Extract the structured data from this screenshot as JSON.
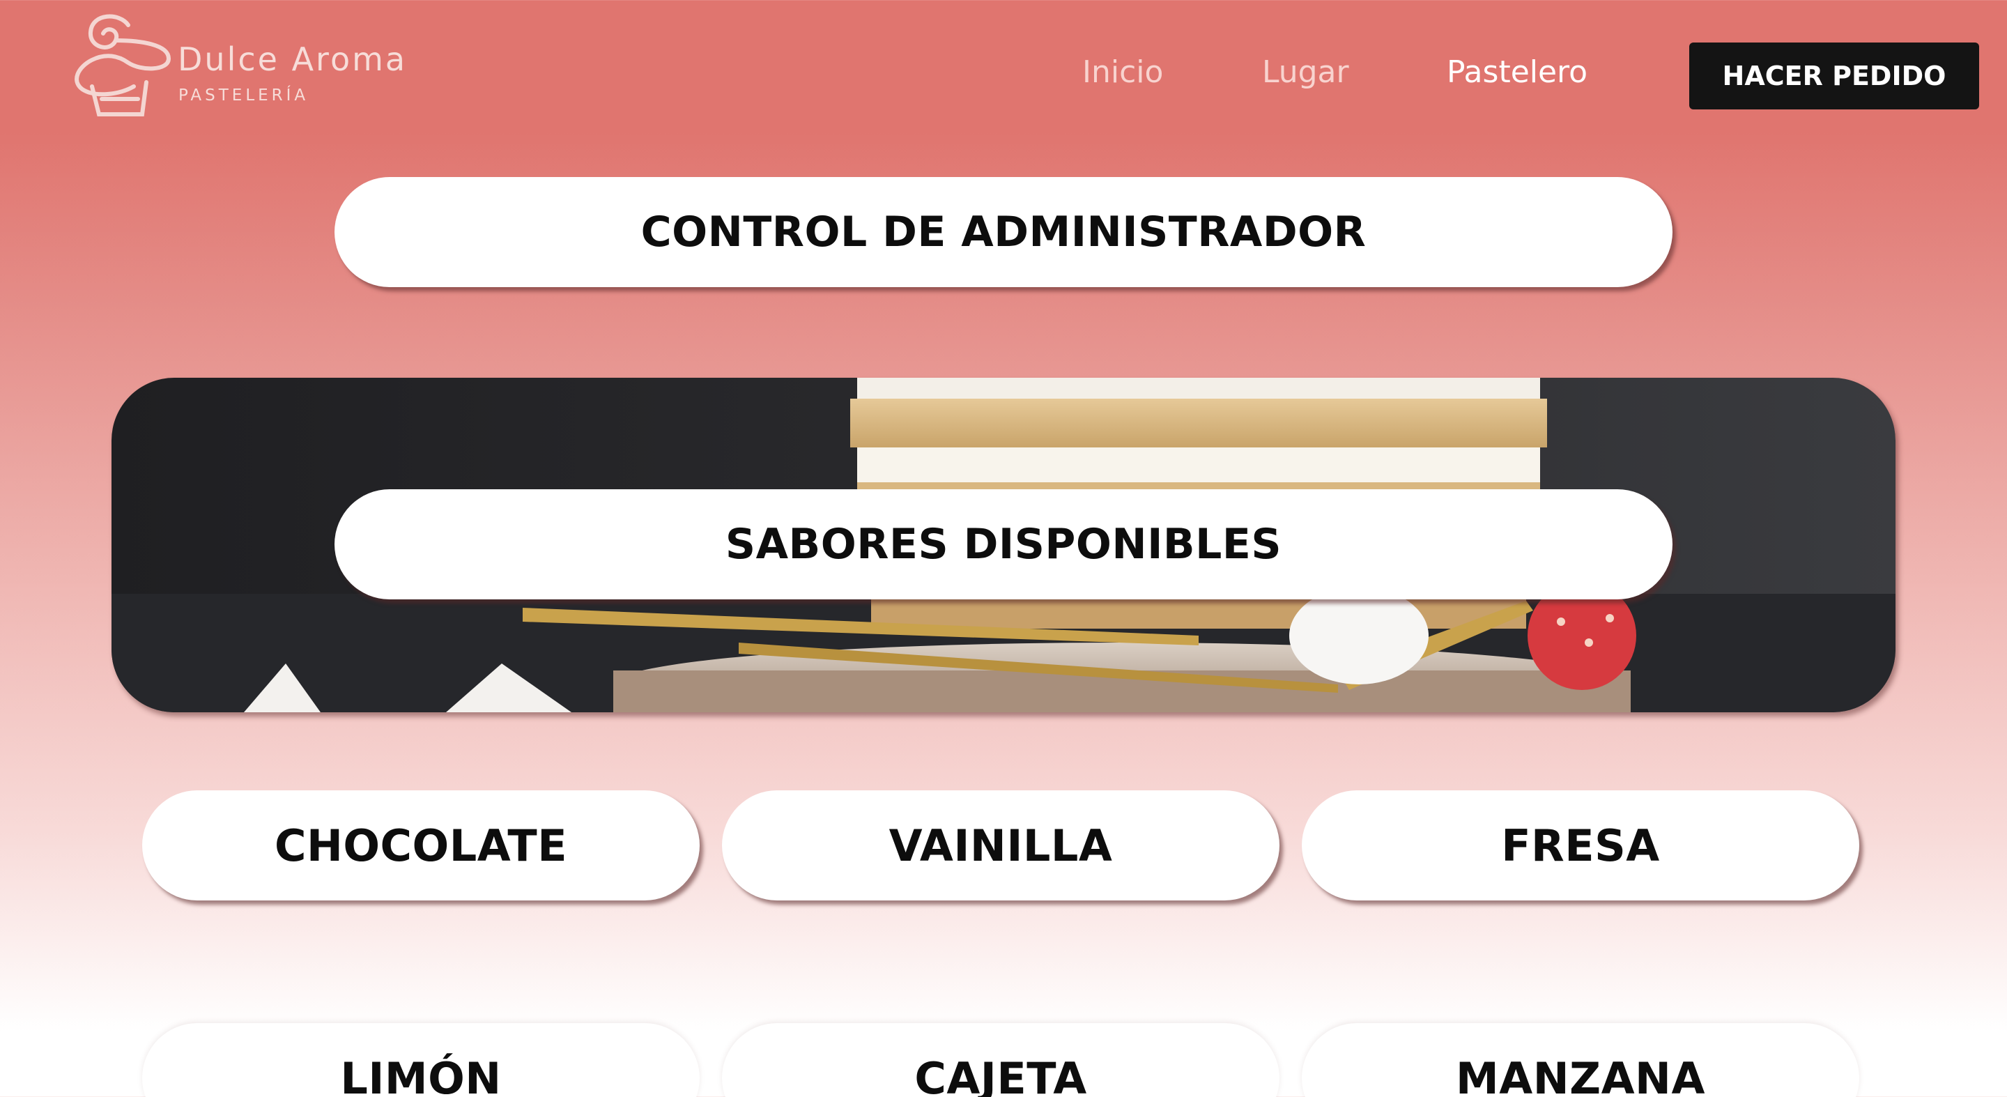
{
  "brand": {
    "name": "Dulce Aroma",
    "tagline": "PASTELERÍA",
    "logo_icon": "cupcake-swirl-icon"
  },
  "nav": {
    "items": [
      {
        "label": "Inicio",
        "active": false
      },
      {
        "label": "Lugar",
        "active": false
      },
      {
        "label": "Pastelero",
        "active": true
      }
    ],
    "order_button": "HACER PEDIDO"
  },
  "admin": {
    "label": "CONTROL DE ADMINISTRADOR"
  },
  "hero": {
    "image": "layered-cake-slice-photo",
    "label": "SABORES DISPONIBLES"
  },
  "flavors": [
    {
      "label": "CHOCOLATE"
    },
    {
      "label": "VAINILLA"
    },
    {
      "label": "FRESA"
    },
    {
      "label": "LIMÓN"
    },
    {
      "label": "CAJETA"
    },
    {
      "label": "MANZANA"
    }
  ],
  "colors": {
    "header_bg": "#e0756f",
    "order_button_bg": "#141414",
    "pill_bg": "#ffffff",
    "text_dark": "#0d0d0d"
  }
}
